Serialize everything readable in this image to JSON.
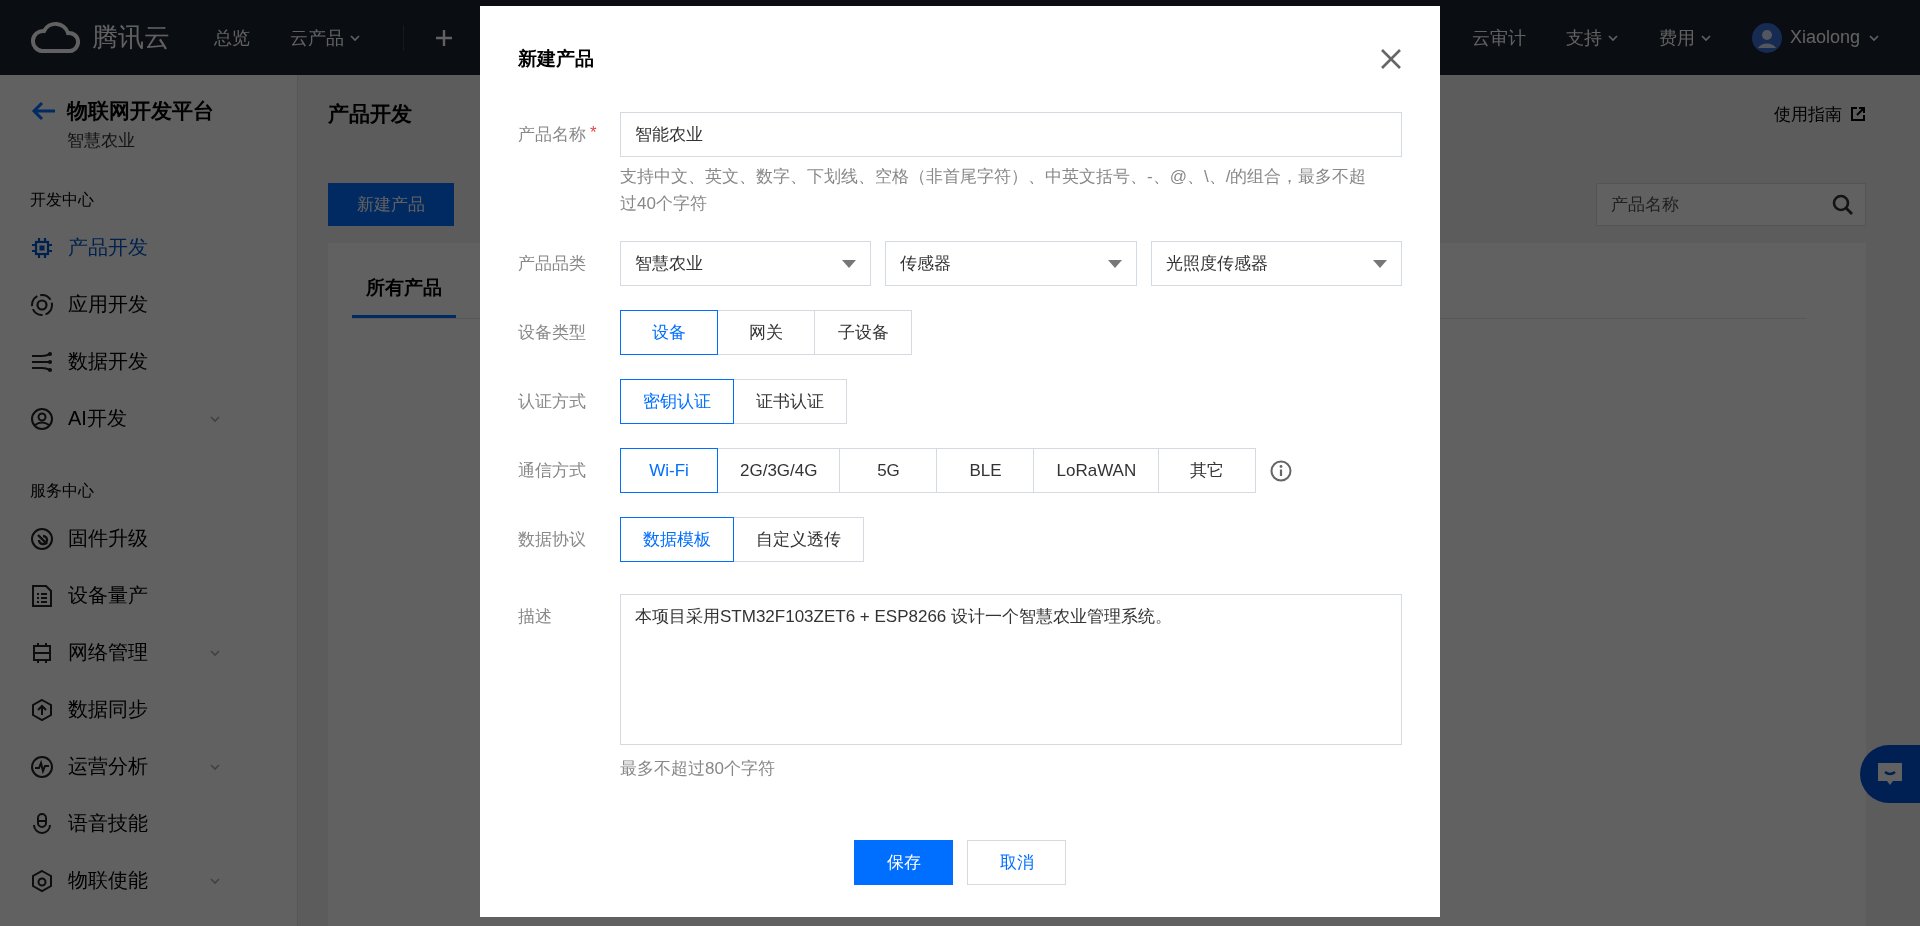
{
  "top_bar": {
    "logo": "腾讯云",
    "nav_left": [
      {
        "label": "总览",
        "dropdown": false
      },
      {
        "label": "云产品",
        "dropdown": true
      }
    ],
    "nav_right": [
      {
        "label": "云审计",
        "dropdown": false
      },
      {
        "label": "支持",
        "dropdown": true
      },
      {
        "label": "费用",
        "dropdown": true
      }
    ],
    "user": {
      "name": "Xiaolong",
      "dropdown": true
    }
  },
  "sidebar": {
    "title": "物联网开发平台",
    "subtitle": "智慧农业",
    "sections": [
      {
        "heading": "开发中心",
        "items": [
          {
            "label": "产品开发",
            "selected": true,
            "expandable": false
          },
          {
            "label": "应用开发",
            "selected": false,
            "expandable": false
          },
          {
            "label": "数据开发",
            "selected": false,
            "expandable": false
          },
          {
            "label": "AI开发",
            "selected": false,
            "expandable": true
          }
        ]
      },
      {
        "heading": "服务中心",
        "items": [
          {
            "label": "固件升级",
            "selected": false,
            "expandable": false
          },
          {
            "label": "设备量产",
            "selected": false,
            "expandable": false
          },
          {
            "label": "网络管理",
            "selected": false,
            "expandable": true
          },
          {
            "label": "数据同步",
            "selected": false,
            "expandable": false
          },
          {
            "label": "运营分析",
            "selected": false,
            "expandable": true
          },
          {
            "label": "语音技能",
            "selected": false,
            "expandable": false
          },
          {
            "label": "物联使能",
            "selected": false,
            "expandable": true
          }
        ]
      }
    ]
  },
  "main": {
    "title": "产品开发",
    "guide_link": "使用指南",
    "new_button": "新建产品",
    "search": {
      "placeholder": "产品名称"
    },
    "tabs": [
      {
        "label": "所有产品",
        "selected": true
      }
    ]
  },
  "dialog": {
    "title": "新建产品",
    "rows": [
      {
        "kind": "text",
        "label": "产品名称",
        "required_mark": "*",
        "value": "智能农业",
        "hint": "支持中文、英文、数字、下划线、空格（非首尾字符）、中英文括号、-、@、\\、/的组合，最多不超过40个字符"
      },
      {
        "kind": "select",
        "label": "产品品类",
        "values": [
          "智慧农业",
          "传感器",
          "光照度传感器"
        ]
      },
      {
        "kind": "segmented",
        "label": "设备类型",
        "options": [
          {
            "label": "设备",
            "selected": true
          },
          {
            "label": "网关",
            "selected": false
          },
          {
            "label": "子设备",
            "selected": false
          }
        ]
      },
      {
        "kind": "segmented",
        "label": "认证方式",
        "options": [
          {
            "label": "密钥认证",
            "selected": true
          },
          {
            "label": "证书认证",
            "selected": false
          }
        ]
      },
      {
        "kind": "segmented",
        "label": "通信方式",
        "info": true,
        "options": [
          {
            "label": "Wi-Fi",
            "selected": true
          },
          {
            "label": "2G/3G/4G",
            "selected": false
          },
          {
            "label": "5G",
            "selected": false
          },
          {
            "label": "BLE",
            "selected": false
          },
          {
            "label": "LoRaWAN",
            "selected": false
          },
          {
            "label": "其它",
            "selected": false
          }
        ]
      },
      {
        "kind": "segmented",
        "label": "数据协议",
        "options": [
          {
            "label": "数据模板",
            "selected": true
          },
          {
            "label": "自定义透传",
            "selected": false
          }
        ]
      },
      {
        "kind": "textarea",
        "label": "描述",
        "value": "本项目采用STM32F103ZET6 + ESP8266 设计一个智慧农业管理系统。",
        "hint": "最多不超过80个字符"
      }
    ],
    "buttons": [
      {
        "label": "保存",
        "primary": true
      },
      {
        "label": "取消",
        "primary": false
      }
    ]
  }
}
